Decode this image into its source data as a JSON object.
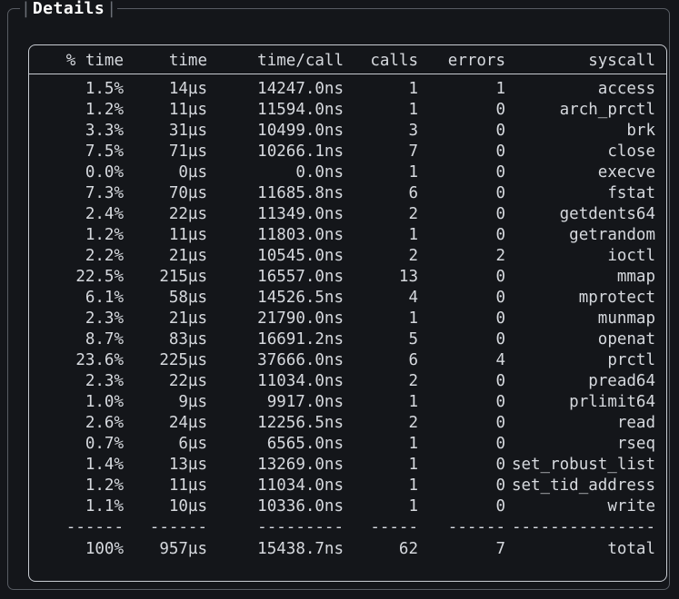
{
  "panel": {
    "title": "Details",
    "title_delimiter": "|",
    "border_color": "#585c63",
    "inner_border_color": "#c8ccd2",
    "background_color": "#14161a",
    "text_color": "#d6d9de",
    "title_color": "#ffffff"
  },
  "table": {
    "columns": [
      {
        "key": "pct_time",
        "label": "% time",
        "align": "right"
      },
      {
        "key": "time",
        "label": "time",
        "align": "right"
      },
      {
        "key": "time_call",
        "label": "time/call",
        "align": "right"
      },
      {
        "key": "calls",
        "label": "calls",
        "align": "right"
      },
      {
        "key": "errors",
        "label": "errors",
        "align": "right"
      },
      {
        "key": "syscall",
        "label": "syscall",
        "align": "right"
      }
    ],
    "separator": {
      "pct_time": "------",
      "time": "------",
      "time_call": "---------",
      "calls": "-----",
      "errors": "------",
      "syscall": "---------------"
    },
    "rows": [
      {
        "pct_time": "1.5%",
        "time": "14µs",
        "time_call": "14247.0ns",
        "calls": "1",
        "errors": "1",
        "syscall": "access"
      },
      {
        "pct_time": "1.2%",
        "time": "11µs",
        "time_call": "11594.0ns",
        "calls": "1",
        "errors": "0",
        "syscall": "arch_prctl"
      },
      {
        "pct_time": "3.3%",
        "time": "31µs",
        "time_call": "10499.0ns",
        "calls": "3",
        "errors": "0",
        "syscall": "brk"
      },
      {
        "pct_time": "7.5%",
        "time": "71µs",
        "time_call": "10266.1ns",
        "calls": "7",
        "errors": "0",
        "syscall": "close"
      },
      {
        "pct_time": "0.0%",
        "time": "0µs",
        "time_call": "0.0ns",
        "calls": "1",
        "errors": "0",
        "syscall": "execve"
      },
      {
        "pct_time": "7.3%",
        "time": "70µs",
        "time_call": "11685.8ns",
        "calls": "6",
        "errors": "0",
        "syscall": "fstat"
      },
      {
        "pct_time": "2.4%",
        "time": "22µs",
        "time_call": "11349.0ns",
        "calls": "2",
        "errors": "0",
        "syscall": "getdents64"
      },
      {
        "pct_time": "1.2%",
        "time": "11µs",
        "time_call": "11803.0ns",
        "calls": "1",
        "errors": "0",
        "syscall": "getrandom"
      },
      {
        "pct_time": "2.2%",
        "time": "21µs",
        "time_call": "10545.0ns",
        "calls": "2",
        "errors": "2",
        "syscall": "ioctl"
      },
      {
        "pct_time": "22.5%",
        "time": "215µs",
        "time_call": "16557.0ns",
        "calls": "13",
        "errors": "0",
        "syscall": "mmap"
      },
      {
        "pct_time": "6.1%",
        "time": "58µs",
        "time_call": "14526.5ns",
        "calls": "4",
        "errors": "0",
        "syscall": "mprotect"
      },
      {
        "pct_time": "2.3%",
        "time": "21µs",
        "time_call": "21790.0ns",
        "calls": "1",
        "errors": "0",
        "syscall": "munmap"
      },
      {
        "pct_time": "8.7%",
        "time": "83µs",
        "time_call": "16691.2ns",
        "calls": "5",
        "errors": "0",
        "syscall": "openat"
      },
      {
        "pct_time": "23.6%",
        "time": "225µs",
        "time_call": "37666.0ns",
        "calls": "6",
        "errors": "4",
        "syscall": "prctl"
      },
      {
        "pct_time": "2.3%",
        "time": "22µs",
        "time_call": "11034.0ns",
        "calls": "2",
        "errors": "0",
        "syscall": "pread64"
      },
      {
        "pct_time": "1.0%",
        "time": "9µs",
        "time_call": "9917.0ns",
        "calls": "1",
        "errors": "0",
        "syscall": "prlimit64"
      },
      {
        "pct_time": "2.6%",
        "time": "24µs",
        "time_call": "12256.5ns",
        "calls": "2",
        "errors": "0",
        "syscall": "read"
      },
      {
        "pct_time": "0.7%",
        "time": "6µs",
        "time_call": "6565.0ns",
        "calls": "1",
        "errors": "0",
        "syscall": "rseq"
      },
      {
        "pct_time": "1.4%",
        "time": "13µs",
        "time_call": "13269.0ns",
        "calls": "1",
        "errors": "0",
        "syscall": "set_robust_list"
      },
      {
        "pct_time": "1.2%",
        "time": "11µs",
        "time_call": "11034.0ns",
        "calls": "1",
        "errors": "0",
        "syscall": "set_tid_address"
      },
      {
        "pct_time": "1.1%",
        "time": "10µs",
        "time_call": "10336.0ns",
        "calls": "1",
        "errors": "0",
        "syscall": "write"
      }
    ],
    "totals": {
      "pct_time": "100%",
      "time": "957µs",
      "time_call": "15438.7ns",
      "calls": "62",
      "errors": "7",
      "syscall": "total"
    }
  }
}
